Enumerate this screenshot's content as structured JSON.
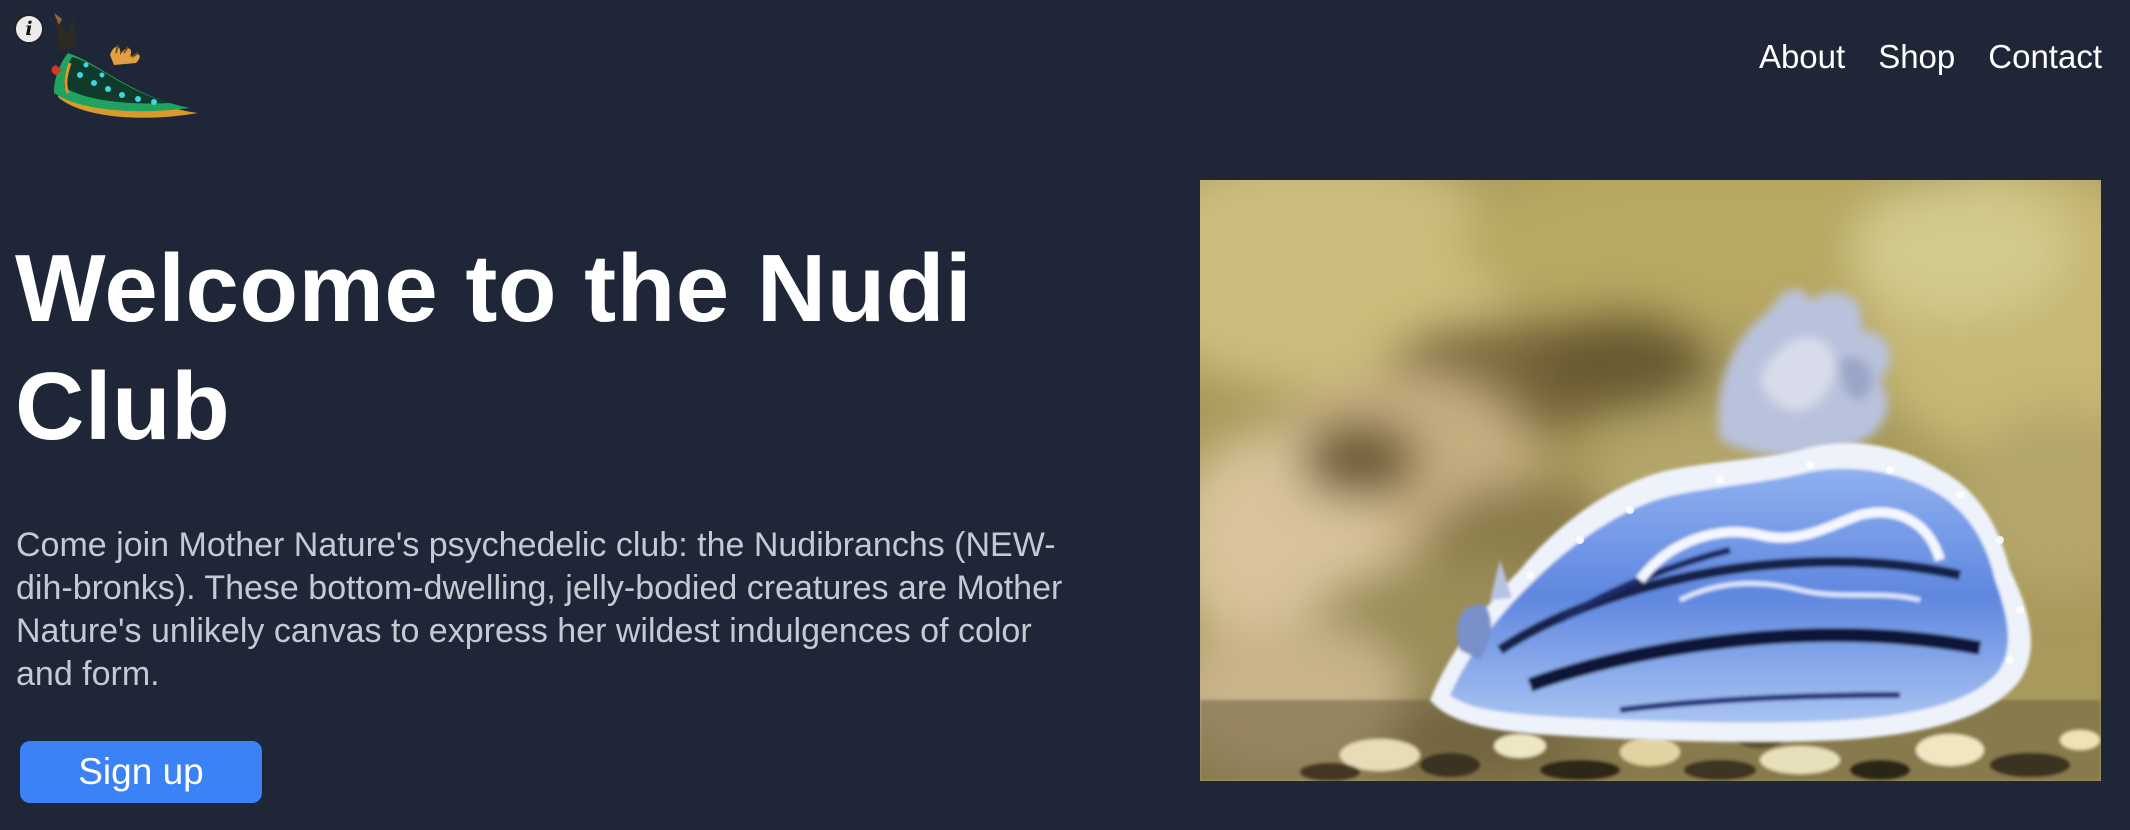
{
  "header": {
    "logo_icon": "nudibranch-logo",
    "info_icon": "info-icon",
    "info_glyph": "i"
  },
  "nav": {
    "items": [
      {
        "label": "About"
      },
      {
        "label": "Shop"
      },
      {
        "label": "Contact"
      }
    ]
  },
  "hero": {
    "title": "Welcome to the Nudi Club",
    "description": "Come join Mother Nature's psychedelic club: the Nudibranchs (NEW-dih-bronks). These bottom-dwelling, jelly-bodied creatures are Mother Nature's unlikely canvas to express her wildest indulgences of color and form.",
    "signup_label": "Sign up",
    "image_icon": "nudibranch-photo"
  },
  "colors": {
    "background": "#1f2637",
    "text": "#ffffff",
    "muted_text": "#c5c9d2",
    "accent": "#3b82f6"
  }
}
